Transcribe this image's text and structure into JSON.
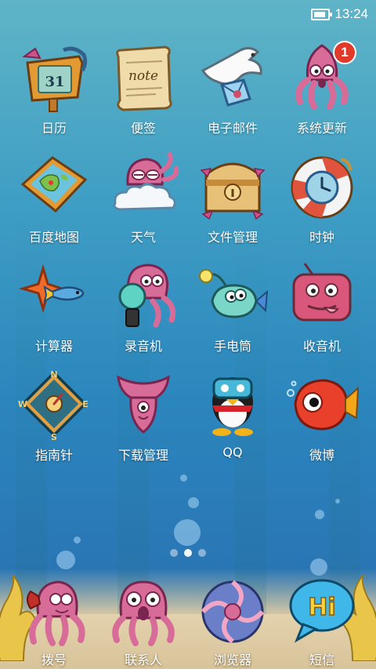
{
  "status_bar": {
    "time": "13:24",
    "battery_level": 0.85
  },
  "apps": [
    {
      "id": "calendar",
      "label": "日历",
      "icon": "calendar-icon",
      "icon_text": "31"
    },
    {
      "id": "notes",
      "label": "便签",
      "icon": "note-scroll-icon",
      "icon_text": "note"
    },
    {
      "id": "email",
      "label": "电子邮件",
      "icon": "dove-mail-icon"
    },
    {
      "id": "system-update",
      "label": "系统更新",
      "icon": "squid-icon",
      "badge": "1"
    },
    {
      "id": "baidu-map",
      "label": "百度地图",
      "icon": "map-icon"
    },
    {
      "id": "weather",
      "label": "天气",
      "icon": "octopus-cloud-icon"
    },
    {
      "id": "file-manager",
      "label": "文件管理",
      "icon": "treasure-chest-icon"
    },
    {
      "id": "clock",
      "label": "时钟",
      "icon": "lifebuoy-clock-icon"
    },
    {
      "id": "calculator",
      "label": "计算器",
      "icon": "fish-star-icon"
    },
    {
      "id": "recorder",
      "label": "录音机",
      "icon": "octopus-recorder-icon"
    },
    {
      "id": "flashlight",
      "label": "手电筒",
      "icon": "anglerfish-icon"
    },
    {
      "id": "radio",
      "label": "收音机",
      "icon": "radio-icon"
    },
    {
      "id": "compass",
      "label": "指南针",
      "icon": "compass-icon",
      "compass_letters": [
        "N",
        "E",
        "S",
        "W"
      ]
    },
    {
      "id": "download-manager",
      "label": "下载管理",
      "icon": "squid-download-icon"
    },
    {
      "id": "qq",
      "label": "QQ",
      "icon": "penguin-icon"
    },
    {
      "id": "weibo",
      "label": "微博",
      "icon": "goldfish-icon"
    }
  ],
  "page_indicator": {
    "count": 3,
    "active_index": 1
  },
  "dock": [
    {
      "id": "dialer",
      "label": "拨号",
      "icon": "octopus-phone-icon"
    },
    {
      "id": "contacts",
      "label": "联系人",
      "icon": "octopus-contacts-icon"
    },
    {
      "id": "browser",
      "label": "浏览器",
      "icon": "shell-browser-icon"
    },
    {
      "id": "messages",
      "label": "短信",
      "icon": "hi-bubble-icon",
      "icon_text": "Hi"
    }
  ]
}
